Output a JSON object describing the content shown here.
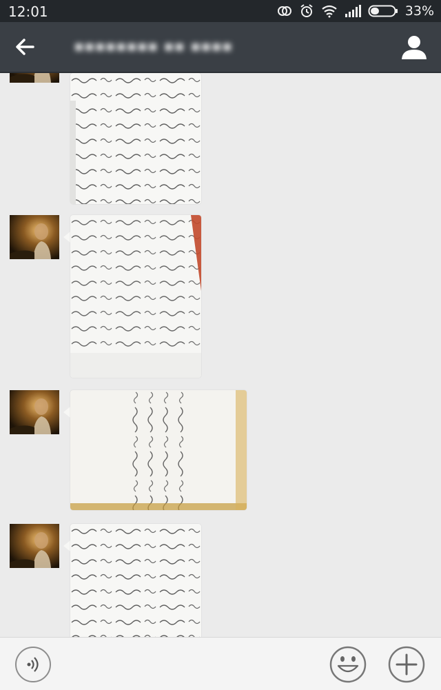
{
  "status_bar": {
    "time": "12:01",
    "battery_percent": "33%",
    "icons": [
      "sync-icon",
      "alarm-clock-icon",
      "wifi-icon",
      "signal-icon",
      "battery-icon"
    ]
  },
  "header": {
    "back_icon": "arrow-left-icon",
    "title": "■■■■■■■■ ■■ ■■■■",
    "title_obscured": true,
    "profile_icon": "person-icon"
  },
  "chat": {
    "messages": [
      {
        "type": "image",
        "content": "handwritten-notes-photo",
        "sender": "contact"
      },
      {
        "type": "image",
        "content": "handwritten-notes-photo",
        "sender": "contact"
      },
      {
        "type": "image",
        "content": "handwritten-notes-photo",
        "sender": "contact"
      },
      {
        "type": "image",
        "content": "handwritten-notes-photo",
        "sender": "contact"
      }
    ]
  },
  "input_bar": {
    "voice_icon": "voice-input-icon",
    "input_value": "",
    "input_placeholder": "",
    "emoji_icon": "emoji-smiley-icon",
    "more_icon": "plus-icon"
  },
  "colors": {
    "status_bar_bg": "#23272b",
    "title_bar_bg": "#3a3f45",
    "chat_bg": "#ebebeb",
    "input_bar_bg": "#f4f4f4"
  }
}
